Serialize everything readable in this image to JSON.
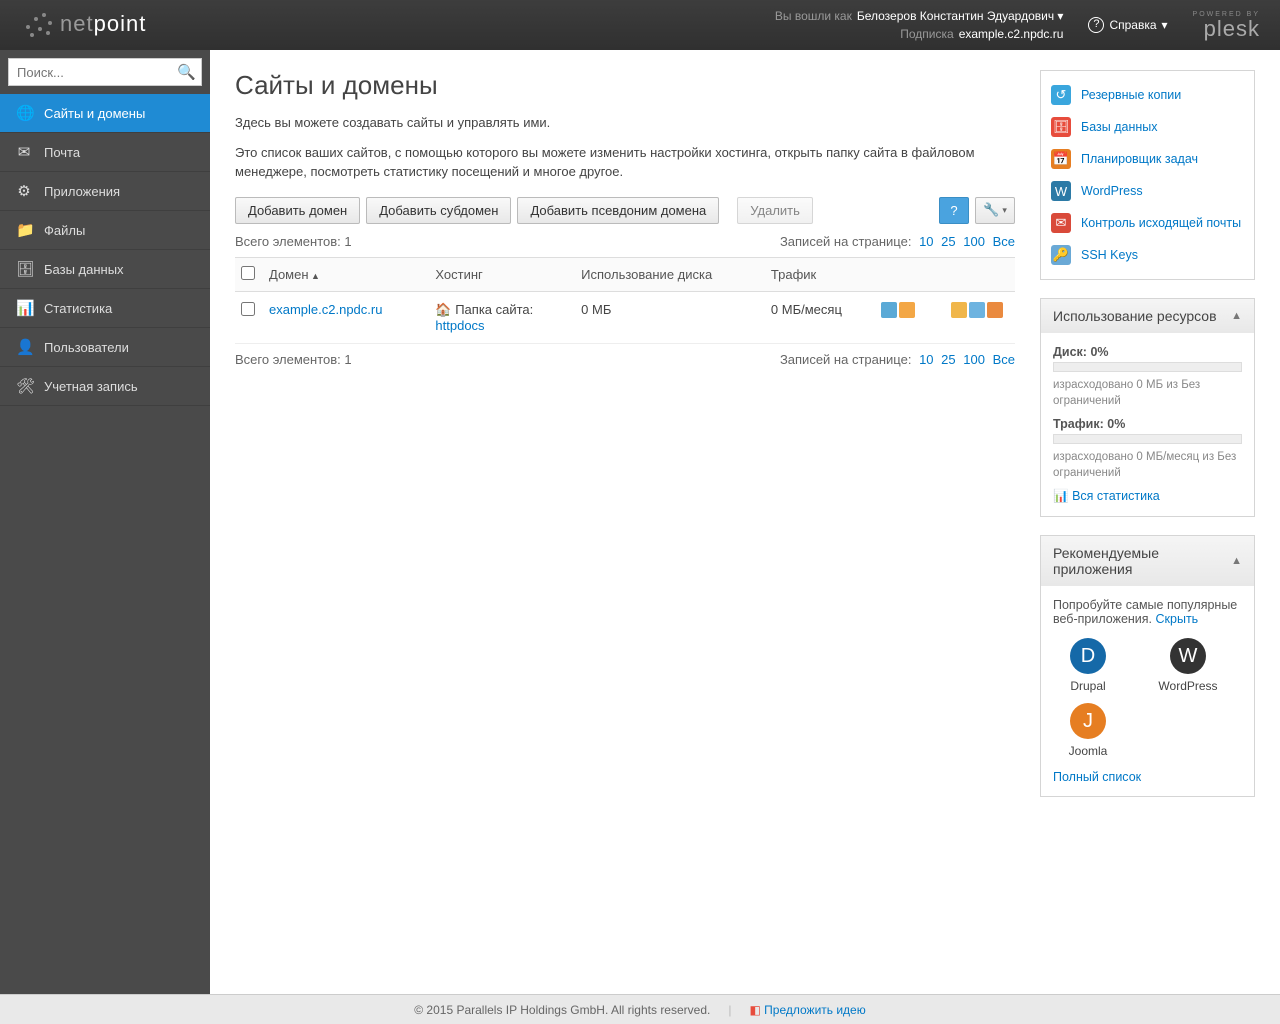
{
  "top": {
    "logged_in_as_label": "Вы вошли как",
    "user": "Белозеров Константин Эдуардович",
    "subscription_label": "Подписка",
    "subscription": "example.c2.npdc.ru",
    "help": "Справка",
    "powered_by": "POWERED BY",
    "plesk": "plesk"
  },
  "search": {
    "placeholder": "Поиск..."
  },
  "nav": [
    {
      "icon": "🌐",
      "label": "Сайты и домены",
      "active": true
    },
    {
      "icon": "✉",
      "label": "Почта"
    },
    {
      "icon": "⚙",
      "label": "Приложения"
    },
    {
      "icon": "📁",
      "label": "Файлы"
    },
    {
      "icon": "🗄",
      "label": "Базы данных"
    },
    {
      "icon": "📊",
      "label": "Статистика"
    },
    {
      "icon": "👤",
      "label": "Пользователи"
    },
    {
      "icon": "🛠",
      "label": "Учетная запись"
    }
  ],
  "page": {
    "title": "Сайты и домены",
    "lead1": "Здесь вы можете создавать сайты и управлять ими.",
    "lead2": "Это список ваших сайтов, с помощью которого вы можете изменить настройки хостинга, открыть папку сайта в файловом менеджере, посмотреть статистику посещений и многое другое."
  },
  "toolbar": {
    "add_domain": "Добавить домен",
    "add_subdomain": "Добавить субдомен",
    "add_alias": "Добавить псевдоним домена",
    "delete": "Удалить"
  },
  "list": {
    "total_label": "Всего элементов:",
    "total": "1",
    "per_page_label": "Записей на странице:",
    "per_page_options": [
      "10",
      "25",
      "100",
      "Все"
    ],
    "cols": {
      "domain": "Домен",
      "hosting": "Хостинг",
      "disk": "Использование диска",
      "traffic": "Трафик"
    },
    "rows": [
      {
        "domain": "example.c2.npdc.ru",
        "hosting_label": "Папка сайта:",
        "hosting_path": "httpdocs",
        "disk": "0 МБ",
        "traffic": "0 МБ/месяц"
      }
    ]
  },
  "tools": [
    {
      "label": "Резервные копии",
      "c": "#3aa6dd",
      "g": "↺"
    },
    {
      "label": "Базы данных",
      "c": "#e74c3c",
      "g": "🗄"
    },
    {
      "label": "Планировщик задач",
      "c": "#e67e22",
      "g": "📅"
    },
    {
      "label": "WordPress",
      "c": "#2c7aa6",
      "g": "W"
    },
    {
      "label": "Контроль исходящей почты",
      "c": "#d94a3a",
      "g": "✉"
    },
    {
      "label": "SSH Keys",
      "c": "#6aa9d6",
      "g": "🔑"
    }
  ],
  "usage": {
    "title": "Использование ресурсов",
    "disk_label": "Диск:",
    "disk_pct": "0%",
    "disk_note": "израсходовано 0 МБ из Без ограничений",
    "traffic_label": "Трафик:",
    "traffic_pct": "0%",
    "traffic_note": "израсходовано 0 МБ/месяц из Без ограничений",
    "all_stats": "Вся статистика"
  },
  "recommended": {
    "title": "Рекомендуемые приложения",
    "intro": "Попробуйте самые популярные веб-приложения.",
    "hide": "Скрыть",
    "apps": [
      {
        "label": "Drupal",
        "c": "#1569a8"
      },
      {
        "label": "WordPress",
        "c": "#333"
      },
      {
        "label": "Joomla",
        "c": "#e67e22"
      }
    ],
    "full_list": "Полный список"
  },
  "footer": {
    "copyright": "© 2015 Parallels IP Holdings GmbH. All rights reserved.",
    "suggest": "Предложить идею"
  }
}
